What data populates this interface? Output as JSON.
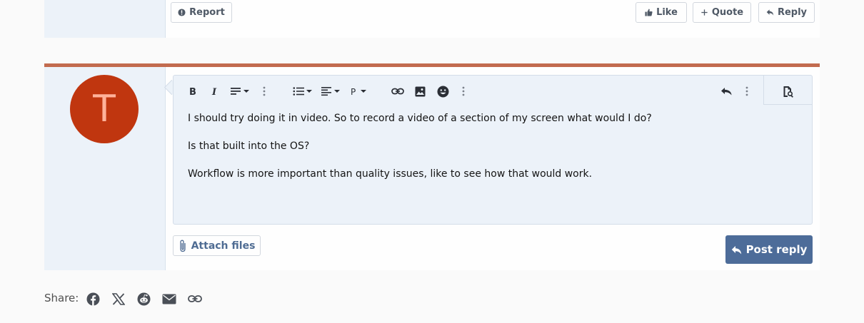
{
  "previous_post": {
    "report_label": "Report",
    "like_label": "Like",
    "quote_label": "Quote",
    "reply_label": "Reply"
  },
  "quick_reply": {
    "avatar_letter": "T",
    "avatar_color": "#c0360f",
    "toolbar": [
      "bold",
      "italic",
      "paragraph-format",
      "more",
      "list",
      "align",
      "style",
      "link",
      "image",
      "emoji",
      "more",
      "undo",
      "more",
      "preview"
    ],
    "message_lines": [
      "I should try doing it in video. So to record a video of a section of my screen what would I do?",
      "Is that built into the OS?",
      "Workflow is more important than quality issues, like to see how that would work."
    ],
    "attach_label": "Attach files",
    "post_label": "Post reply"
  },
  "share": {
    "label": "Share:",
    "icons": [
      "facebook-icon",
      "x-icon",
      "reddit-icon",
      "email-icon",
      "link-icon"
    ]
  },
  "colors": {
    "accent": "#c26b4f",
    "primary_button": "#4d6c99",
    "editor_bg": "#ecf2f9"
  }
}
